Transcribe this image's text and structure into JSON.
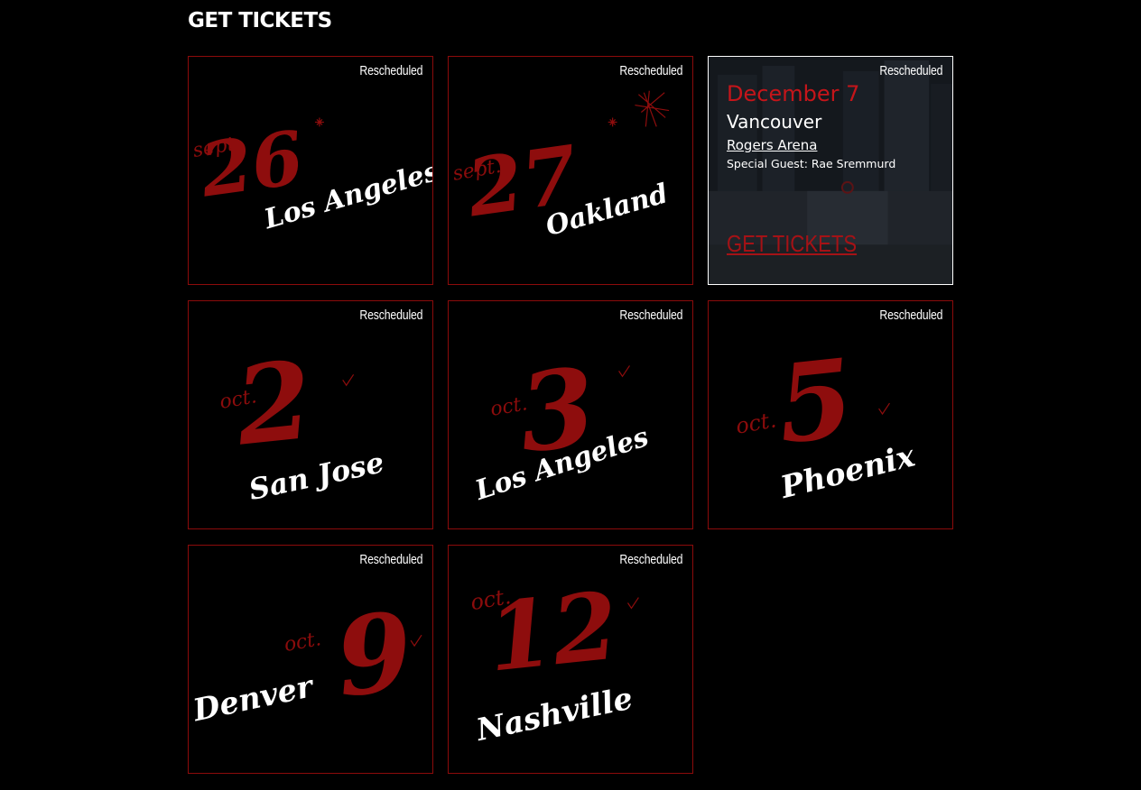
{
  "page": {
    "title": "GET TICKETS"
  },
  "colors": {
    "background": "#000000",
    "card_border": "#8c0b0b",
    "accent_red": "#8e0d0d",
    "date_red": "#c5151a"
  },
  "shows": [
    {
      "status": "Rescheduled",
      "month": "sept.",
      "day": "26",
      "city": "Los Angeles"
    },
    {
      "status": "Rescheduled",
      "month": "sept.",
      "day": "27",
      "city": "Oakland"
    },
    {
      "status": "Rescheduled",
      "active": true,
      "date": "December 7",
      "city": "Vancouver",
      "venue": "Rogers Arena",
      "guest": "Special Guest: Rae Sremmurd",
      "cta": "GET TICKETS"
    },
    {
      "status": "Rescheduled",
      "month": "oct.",
      "day": "2",
      "city": "San Jose"
    },
    {
      "status": "Rescheduled",
      "month": "oct.",
      "day": "3",
      "city": "Los Angeles"
    },
    {
      "status": "Rescheduled",
      "month": "oct.",
      "day": "5",
      "city": "Phoenix"
    },
    {
      "status": "Rescheduled",
      "month": "oct.",
      "day": "9",
      "city": "Denver"
    },
    {
      "status": "Rescheduled",
      "month": "oct.",
      "day": "12",
      "city": "Nashville"
    }
  ]
}
